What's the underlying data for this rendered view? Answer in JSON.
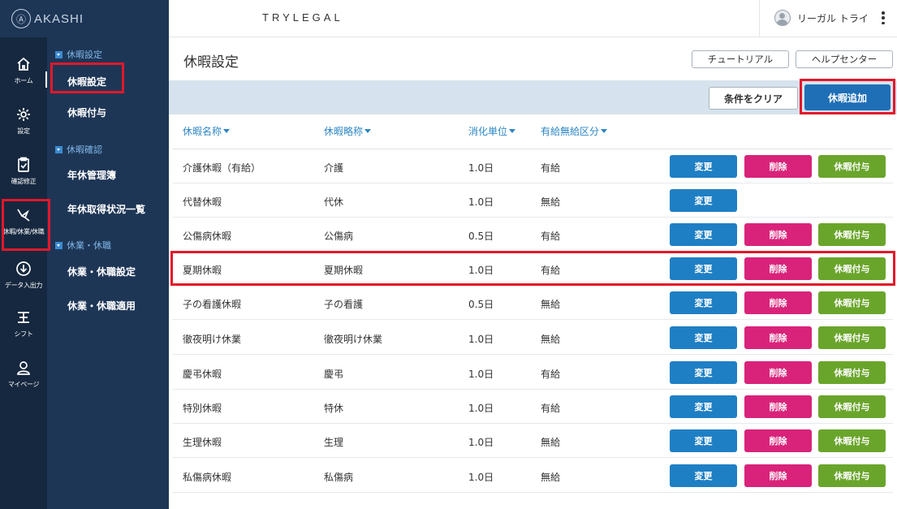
{
  "app": {
    "logo_text": "AKASHI",
    "logo_mark": "Ⓐ",
    "brand": "TRYLEGAL",
    "user_name": "リーガル トライ"
  },
  "rail": {
    "items": [
      {
        "label": "ホーム",
        "icon": "home-icon"
      },
      {
        "label": "設定",
        "icon": "gear-icon"
      },
      {
        "label": "確認修正",
        "icon": "clipboard-check-icon"
      },
      {
        "label": "休暇/休業/休職",
        "icon": "bird-icon"
      },
      {
        "label": "データ入出力",
        "icon": "download-icon"
      },
      {
        "label": "シフト",
        "icon": "shift-icon"
      },
      {
        "label": "マイページ",
        "icon": "person-icon"
      }
    ]
  },
  "subnav": {
    "sections": [
      {
        "title": "休暇設定",
        "items": [
          "休暇設定",
          "休暇付与"
        ]
      },
      {
        "title": "休暇確認",
        "items": [
          "年休管理簿",
          "年休取得状況一覧"
        ]
      },
      {
        "title": "休業・休職",
        "items": [
          "休業・休職設定",
          "休業・休職適用"
        ]
      }
    ]
  },
  "main": {
    "title": "休暇設定",
    "tutorial_label": "チュートリアル",
    "help_label": "ヘルプセンター",
    "clear_label": "条件をクリア",
    "add_label": "休暇追加"
  },
  "table": {
    "headers": [
      "休暇名称",
      "休暇略称",
      "消化単位",
      "有給無給区分"
    ],
    "edit_label": "変更",
    "delete_label": "削除",
    "grant_label": "休暇付与",
    "rows": [
      {
        "name": "介護休暇（有給）",
        "abbr": "介護",
        "unit": "1.0日",
        "type": "有給",
        "actions": [
          "edit",
          "delete",
          "grant"
        ]
      },
      {
        "name": "代替休暇",
        "abbr": "代休",
        "unit": "1.0日",
        "type": "無給",
        "actions": [
          "edit"
        ]
      },
      {
        "name": "公傷病休暇",
        "abbr": "公傷病",
        "unit": "0.5日",
        "type": "有給",
        "actions": [
          "edit",
          "delete",
          "grant"
        ]
      },
      {
        "name": "夏期休暇",
        "abbr": "夏期休暇",
        "unit": "1.0日",
        "type": "有給",
        "actions": [
          "edit",
          "delete",
          "grant"
        ]
      },
      {
        "name": "子の看護休暇",
        "abbr": "子の看護",
        "unit": "0.5日",
        "type": "無給",
        "actions": [
          "edit",
          "delete",
          "grant"
        ]
      },
      {
        "name": "徹夜明け休業",
        "abbr": "徹夜明け休業",
        "unit": "1.0日",
        "type": "無給",
        "actions": [
          "edit",
          "delete",
          "grant"
        ]
      },
      {
        "name": "慶弔休暇",
        "abbr": "慶弔",
        "unit": "1.0日",
        "type": "有給",
        "actions": [
          "edit",
          "delete",
          "grant"
        ]
      },
      {
        "name": "特別休暇",
        "abbr": "特休",
        "unit": "1.0日",
        "type": "有給",
        "actions": [
          "edit",
          "delete",
          "grant"
        ]
      },
      {
        "name": "生理休暇",
        "abbr": "生理",
        "unit": "1.0日",
        "type": "無給",
        "actions": [
          "edit",
          "delete",
          "grant"
        ]
      },
      {
        "name": "私傷病休暇",
        "abbr": "私傷病",
        "unit": "1.0日",
        "type": "無給",
        "actions": [
          "edit",
          "delete",
          "grant"
        ]
      }
    ]
  },
  "colors": {
    "rail": "#16283f",
    "subnav": "#1e3656",
    "accent": "#1f6fb6",
    "delete": "#d9237a",
    "grant": "#6aa52b",
    "annotation": "#e2182a"
  }
}
